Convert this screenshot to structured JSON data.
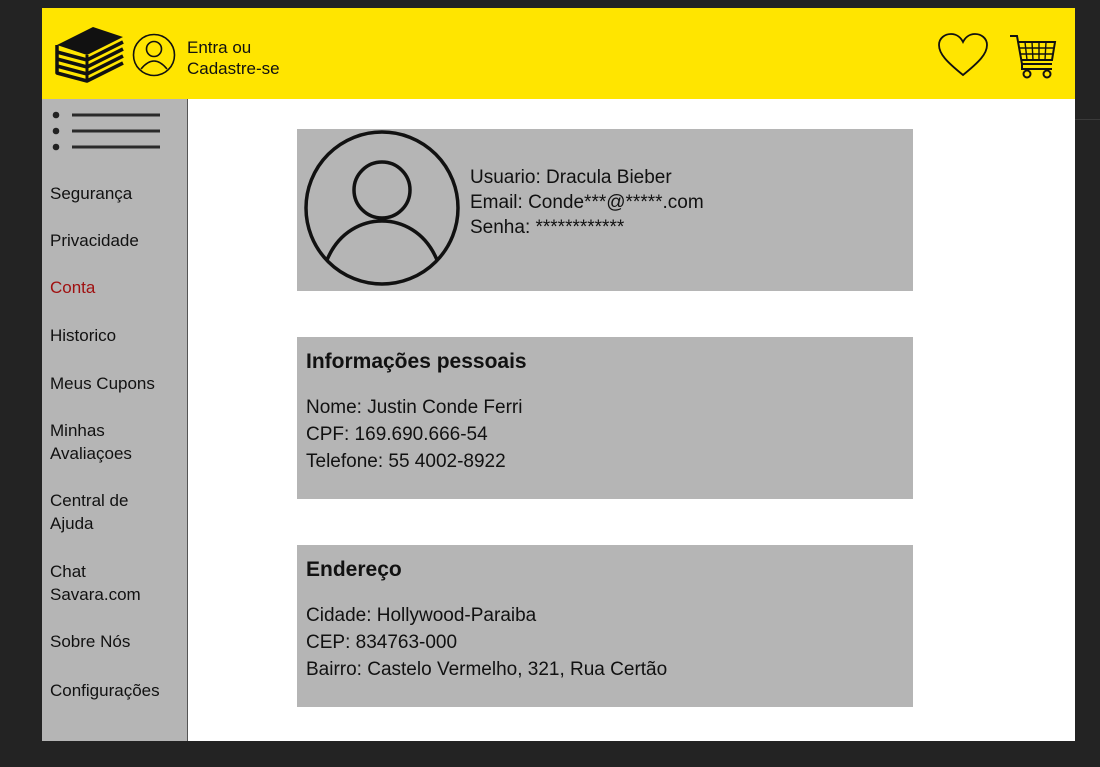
{
  "header": {
    "login_line1": "Entra ou",
    "login_line2": "Cadastre-se",
    "icons": [
      "books-logo-icon",
      "user-icon",
      "heart-icon",
      "cart-icon"
    ],
    "background_color": "#ffe500"
  },
  "sidebar": {
    "menu_icon": "menu-icon",
    "items": [
      {
        "label": "Segurança"
      },
      {
        "label": "Privacidade"
      },
      {
        "label": "Conta",
        "active": true
      },
      {
        "label": "Historico"
      },
      {
        "label": "Meus Cupons"
      },
      {
        "label": "Minhas\nAvaliaçoes"
      },
      {
        "label": "Central de\nAjuda"
      },
      {
        "label": "Chat\nSavara.com"
      },
      {
        "label": "Sobre Nós"
      },
      {
        "label": "Configurações"
      }
    ],
    "active_color": "#a01010"
  },
  "profile": {
    "usuario": "Usuario: Dracula Bieber",
    "email": "Email: Conde***@*****.com",
    "senha": "Senha: ************"
  },
  "personal_info": {
    "title": "Informações pessoais",
    "nome": "Nome: Justin Conde Ferri",
    "cpf": "CPF: 169.690.666-54",
    "telefone": "Telefone: 55 4002-8922"
  },
  "address": {
    "title": "Endereço",
    "cidade": "Cidade: Hollywood-Paraiba",
    "cep": "CEP: 834763-000",
    "bairro": "Bairro: Castelo Vermelho, 321, Rua Certão"
  }
}
